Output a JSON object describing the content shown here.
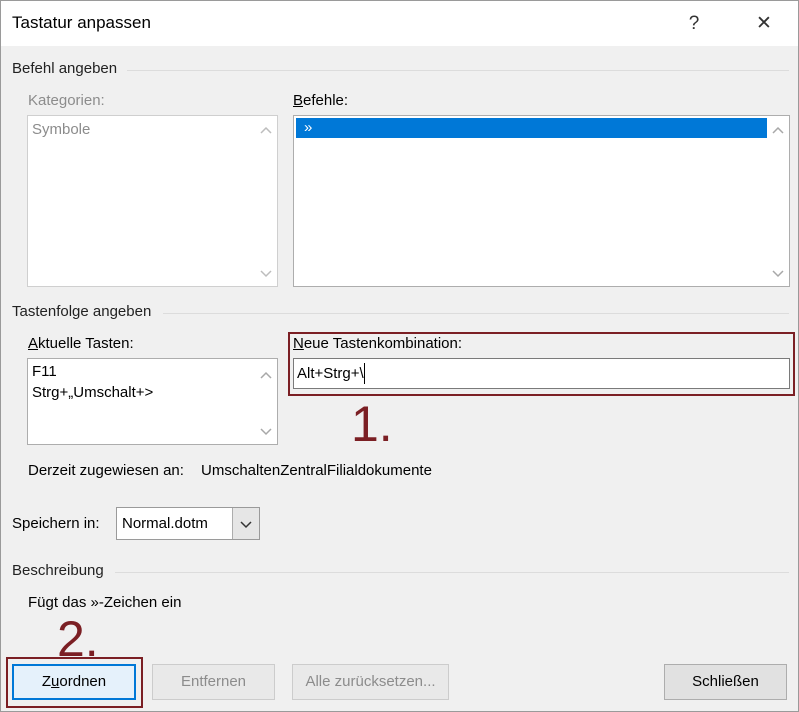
{
  "window": {
    "title": "Tastatur anpassen",
    "help_glyph": "?",
    "close_glyph": "✕"
  },
  "command_section": {
    "heading": "Befehl angeben",
    "categories_label": "Kategorien:",
    "categories_items": [
      "Symbole"
    ],
    "commands_label_underlined": "B",
    "commands_label_rest": "efehle:",
    "commands_items": [
      "»"
    ],
    "commands_selected_index": 0
  },
  "keys_section": {
    "heading": "Tastenfolge angeben",
    "current_label_underlined": "A",
    "current_label_rest": "ktuelle Tasten:",
    "current_keys": [
      "F11",
      "Strg+„Umschalt+>"
    ],
    "new_label_underlined": "N",
    "new_label_rest": "eue Tastenkombination:",
    "new_value": "Alt+Strg+\\",
    "assigned_label": "Derzeit zugewiesen an:",
    "assigned_value": "UmschaltenZentralFilialdokumente"
  },
  "save_in": {
    "label": "Speichern in:",
    "selected": "Normal.dotm"
  },
  "description": {
    "heading": "Beschreibung",
    "text": "Fügt das »-Zeichen ein"
  },
  "buttons": {
    "assign_underlined_pre": "Z",
    "assign_underlined": "u",
    "assign_rest": "ordnen",
    "remove": "Entfernen",
    "reset_all": "Alle zurücksetzen...",
    "close": "Schließen"
  },
  "annotations": {
    "step1": "1.",
    "step2": "2.",
    "color": "#7b1f24"
  },
  "colors": {
    "selection": "#0078d7",
    "default_button_border": "#0078d7"
  }
}
